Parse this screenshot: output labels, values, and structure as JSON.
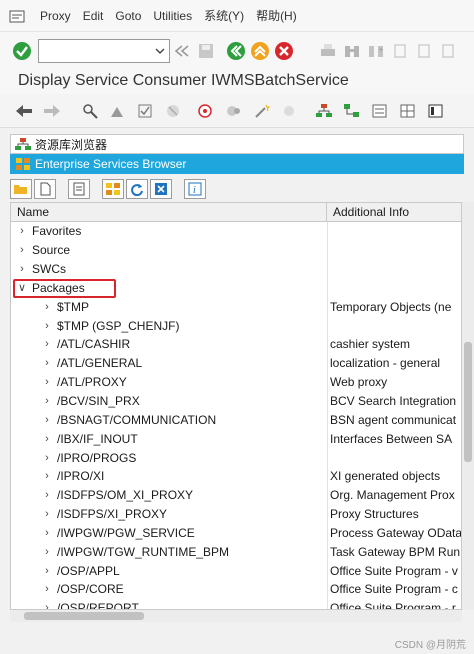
{
  "menubar": {
    "items": [
      {
        "label": "Proxy"
      },
      {
        "label": "Edit"
      },
      {
        "label": "Goto"
      },
      {
        "label": "Utilities"
      },
      {
        "label": "系统(Y)"
      },
      {
        "label": "帮助(H)"
      }
    ]
  },
  "toolbar": {
    "command_value": ""
  },
  "window": {
    "title": "Display Service Consumer IWMSBatchService"
  },
  "panels": {
    "repo_browser": "资源库浏览器",
    "es_browser": "Enterprise Services Browser"
  },
  "tree": {
    "columns": {
      "name": "Name",
      "info": "Additional Info"
    },
    "rows": [
      {
        "name": "Favorites",
        "info": "",
        "level": 0,
        "expanded": false
      },
      {
        "name": "Source",
        "info": "",
        "level": 0,
        "expanded": false
      },
      {
        "name": "SWCs",
        "info": "",
        "level": 0,
        "expanded": false
      },
      {
        "name": "Packages",
        "info": "",
        "level": 0,
        "expanded": true
      },
      {
        "name": "$TMP",
        "info": "Temporary Objects (ne",
        "level": 1,
        "expanded": false
      },
      {
        "name": "$TMP (GSP_CHENJF)",
        "info": "",
        "level": 1,
        "expanded": false
      },
      {
        "name": "/ATL/CASHIR",
        "info": "cashier system",
        "level": 1,
        "expanded": false
      },
      {
        "name": "/ATL/GENERAL",
        "info": "localization - general",
        "level": 1,
        "expanded": false
      },
      {
        "name": "/ATL/PROXY",
        "info": "Web proxy",
        "level": 1,
        "expanded": false
      },
      {
        "name": "/BCV/SIN_PRX",
        "info": "BCV Search Integration",
        "level": 1,
        "expanded": false
      },
      {
        "name": "/BSNAGT/COMMUNICATION",
        "info": "BSN agent communicat",
        "level": 1,
        "expanded": false
      },
      {
        "name": "/IBX/IF_INOUT",
        "info": "Interfaces Between SA",
        "level": 1,
        "expanded": false
      },
      {
        "name": "/IPRO/PROGS",
        "info": "",
        "level": 1,
        "expanded": false
      },
      {
        "name": "/IPRO/XI",
        "info": "XI generated objects",
        "level": 1,
        "expanded": false
      },
      {
        "name": "/ISDFPS/OM_XI_PROXY",
        "info": "Org. Management Prox",
        "level": 1,
        "expanded": false
      },
      {
        "name": "/ISDFPS/XI_PROXY",
        "info": "Proxy Structures",
        "level": 1,
        "expanded": false
      },
      {
        "name": "/IWPGW/PGW_SERVICE",
        "info": "Process Gateway OData",
        "level": 1,
        "expanded": false
      },
      {
        "name": "/IWPGW/TGW_RUNTIME_BPM",
        "info": "Task Gateway BPM Run",
        "level": 1,
        "expanded": false
      },
      {
        "name": "/OSP/APPL",
        "info": "Office Suite Program - v",
        "level": 1,
        "expanded": false
      },
      {
        "name": "/OSP/CORE",
        "info": "Office Suite Program - c",
        "level": 1,
        "expanded": false
      },
      {
        "name": "/OSP/REPORT",
        "info": "Office Suite Program - r",
        "level": 1,
        "expanded": false
      }
    ]
  },
  "watermark": "CSDN @月阴荒",
  "icons": {
    "menu": "menu-icon",
    "enter": "enter-check-icon",
    "back": "back-icon",
    "exit": "exit-icon",
    "cancel": "cancel-icon",
    "save": "save-icon",
    "print": "print-icon",
    "find": "find-icon"
  },
  "colors": {
    "selection": "#1fa7dd",
    "highlight_box": "#d9262c",
    "ok_green": "#2e9e3e"
  }
}
